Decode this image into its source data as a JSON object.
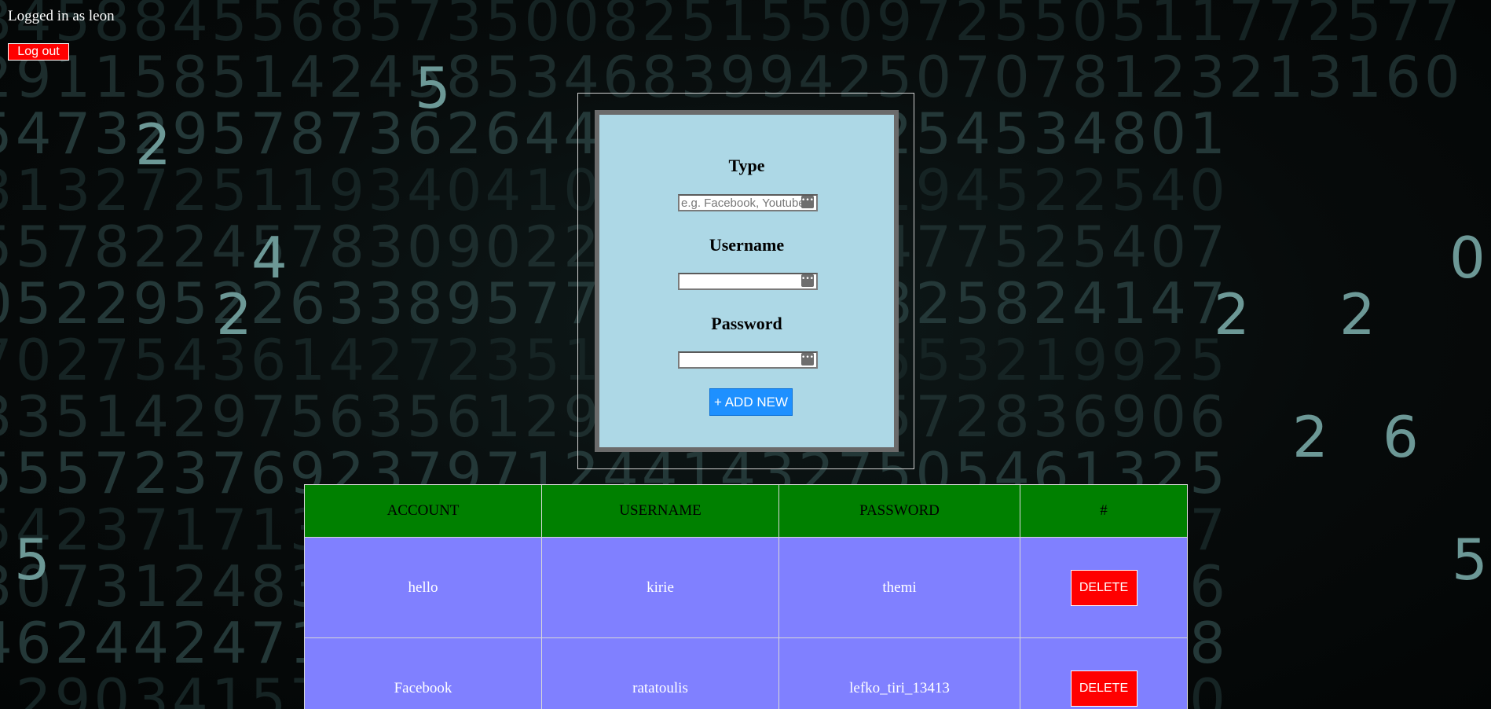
{
  "session": {
    "status_text": "Logged in as leon",
    "logout_label": "Log out"
  },
  "form": {
    "type_label": "Type",
    "type_placeholder": "e.g. Facebook, Youtube",
    "type_value": "",
    "username_label": "Username",
    "username_value": "",
    "password_label": "Password",
    "password_value": "",
    "add_label": "+ ADD NEW"
  },
  "table": {
    "headers": [
      "ACCOUNT",
      "USERNAME",
      "PASSWORD",
      "#"
    ],
    "rows": [
      {
        "account": "hello",
        "username": "kirie",
        "password": "themi",
        "action": "DELETE"
      },
      {
        "account": "Facebook",
        "username": "ratatoulis",
        "password": "lefko_tiri_13413",
        "action": "DELETE"
      }
    ]
  },
  "colors": {
    "logout_bg": "#ff0000",
    "panel_bg": "#add8e6",
    "add_button_bg": "#1e90ff",
    "table_header_bg": "#008000",
    "table_row_bg": "#8080ff",
    "delete_bg": "#ff0000"
  },
  "icons": {
    "password_manager": "password-manager-icon"
  }
}
